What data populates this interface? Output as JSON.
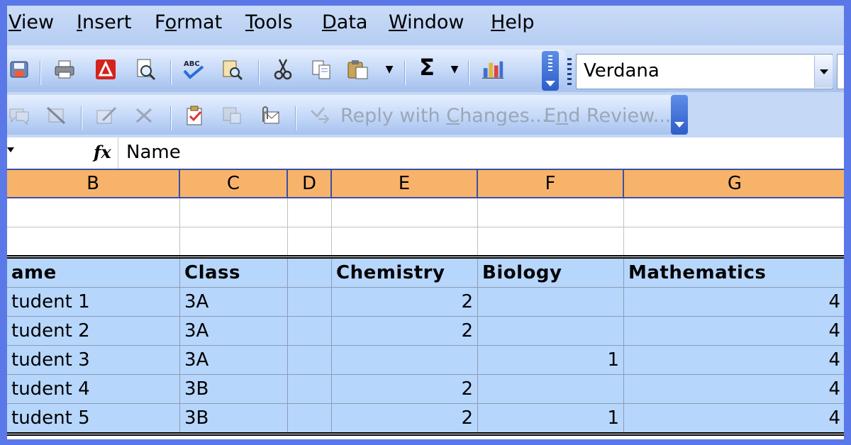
{
  "menu": {
    "items": [
      {
        "pre": "",
        "u": "V",
        "post": "iew"
      },
      {
        "pre": "",
        "u": "I",
        "post": "nsert"
      },
      {
        "pre": "F",
        "u": "o",
        "post": "rmat"
      },
      {
        "pre": "",
        "u": "T",
        "post": "ools"
      },
      {
        "pre": "",
        "u": "D",
        "post": "ata"
      },
      {
        "pre": "",
        "u": "W",
        "post": "indow"
      },
      {
        "pre": "",
        "u": "H",
        "post": "elp"
      }
    ]
  },
  "toolbar": {
    "sum_symbol": "Σ",
    "font_name": "Verdana"
  },
  "review_toolbar": {
    "reply_pre": "Reply with ",
    "reply_u": "C",
    "reply_post": "hanges...",
    "end_pre": "E",
    "end_u": "n",
    "end_post": "d Review..."
  },
  "formula_bar": {
    "fx_label": "fx",
    "value": "Name"
  },
  "columns": [
    "B",
    "C",
    "D",
    "E",
    "F",
    "G"
  ],
  "table": {
    "headers": [
      "ame",
      "Class",
      "",
      "Chemistry",
      "Biology",
      "Mathematics"
    ],
    "rows": [
      [
        "tudent 1",
        "3A",
        "",
        "2",
        "",
        "4"
      ],
      [
        "tudent 2",
        "3A",
        "",
        "2",
        "",
        "4"
      ],
      [
        "tudent 3",
        "3A",
        "",
        "",
        "1",
        "4"
      ],
      [
        "tudent 4",
        "3B",
        "",
        "2",
        "",
        "4"
      ],
      [
        "tudent 5",
        "3B",
        "",
        "2",
        "1",
        "4"
      ]
    ]
  },
  "colors": {
    "frame": "#5b78e8",
    "column_header": "#f8b36b",
    "selection": "#b7d6fc"
  }
}
